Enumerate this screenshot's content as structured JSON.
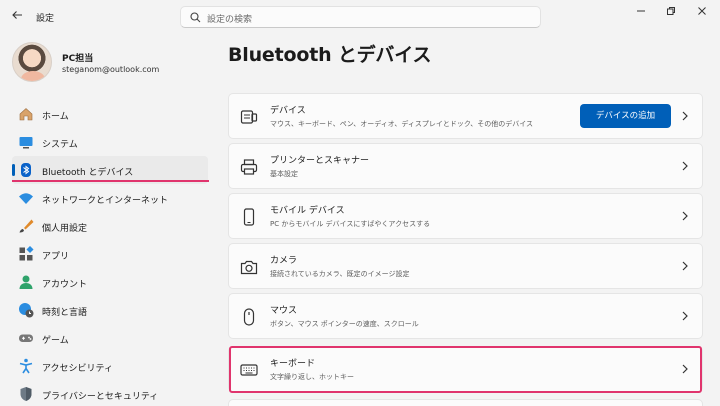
{
  "window": {
    "title": "設定",
    "back_icon": "back-arrow-icon",
    "controls": [
      "minimize-icon",
      "restore-icon",
      "close-icon"
    ]
  },
  "search": {
    "placeholder": "設定の検索"
  },
  "profile": {
    "name": "PC担当",
    "email": "steganom@outlook.com"
  },
  "sidebar": {
    "items": [
      {
        "label": "ホーム",
        "icon": "home-icon"
      },
      {
        "label": "システム",
        "icon": "system-icon"
      },
      {
        "label": "Bluetooth とデバイス",
        "icon": "bluetooth-icon",
        "active": true
      },
      {
        "label": "ネットワークとインターネット",
        "icon": "wifi-icon"
      },
      {
        "label": "個人用設定",
        "icon": "brush-icon"
      },
      {
        "label": "アプリ",
        "icon": "apps-icon"
      },
      {
        "label": "アカウント",
        "icon": "account-icon"
      },
      {
        "label": "時刻と言語",
        "icon": "globe-clock-icon"
      },
      {
        "label": "ゲーム",
        "icon": "gamepad-icon"
      },
      {
        "label": "アクセシビリティ",
        "icon": "accessibility-icon"
      },
      {
        "label": "プライバシーとセキュリティ",
        "icon": "shield-icon"
      }
    ]
  },
  "main": {
    "title": "Bluetooth とデバイス",
    "cards": [
      {
        "title": "デバイス",
        "subtitle": "マウス、キーボード、ペン、オーディオ、ディスプレイとドック、その他のデバイス",
        "icon": "devices-icon",
        "button": "デバイスの追加"
      },
      {
        "title": "プリンターとスキャナー",
        "subtitle": "基本設定",
        "icon": "printer-icon"
      },
      {
        "title": "モバイル デバイス",
        "subtitle": "PC からモバイル デバイスにすばやくアクセスする",
        "icon": "phone-icon"
      },
      {
        "title": "カメラ",
        "subtitle": "接続されているカメラ、既定のイメージ設定",
        "icon": "camera-icon"
      },
      {
        "title": "マウス",
        "subtitle": "ボタン、マウス ポインターの速度、スクロール",
        "icon": "mouse-icon"
      },
      {
        "title": "キーボード",
        "subtitle": "文字繰り返し、ホットキー",
        "icon": "keyboard-icon",
        "highlighted": true
      }
    ]
  },
  "colors": {
    "accent": "#005fb8",
    "highlight": "#e0346d",
    "background": "#f3f3f3",
    "card": "#fbfbfb"
  }
}
